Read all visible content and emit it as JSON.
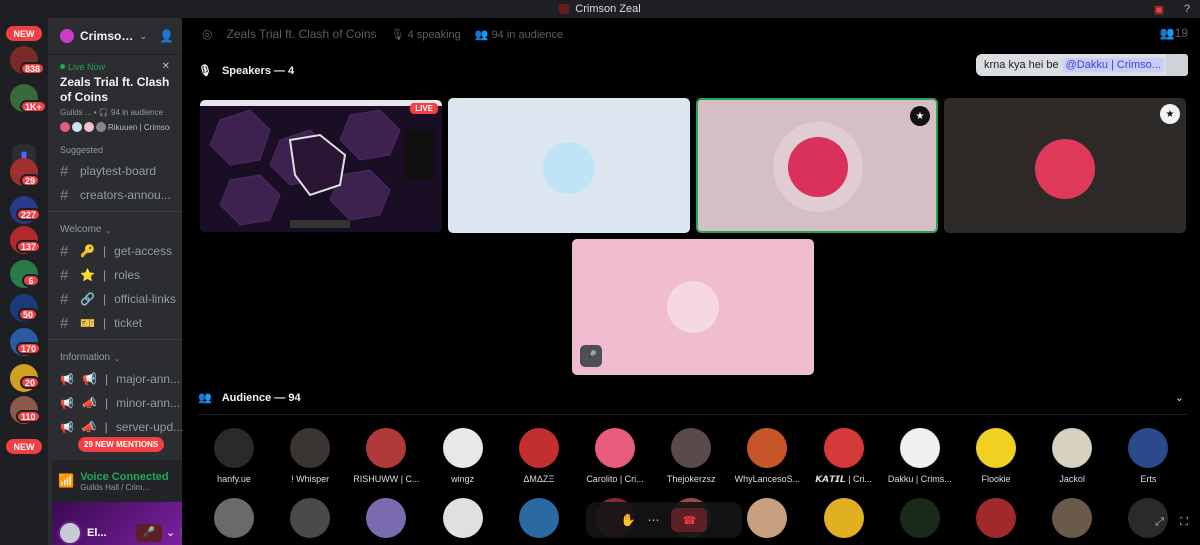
{
  "window": {
    "title": "Crimson Zeal"
  },
  "rail": {
    "new_top": "NEW",
    "new_bottom": "NEW",
    "badges": [
      "838",
      "1K+",
      "29",
      "227",
      "137",
      "6",
      "50",
      "170",
      "20",
      "110"
    ]
  },
  "sidebar": {
    "server_name": "Crimson ...",
    "live": {
      "status": "Live Now",
      "title": "Zeals Trial ft. Clash of Coins",
      "meta_location": "Guilds ...",
      "meta_audience": "94 in audience",
      "speakers_line": "Rikuuen | Crimson Z..."
    },
    "cat_suggested": "Suggested",
    "channels_suggested": [
      "playtest-board",
      "creators-annou..."
    ],
    "cat_welcome": "Welcome",
    "channels_welcome": [
      {
        "emoji": "🔑",
        "name": "get-access"
      },
      {
        "emoji": "⭐",
        "name": "roles"
      },
      {
        "emoji": "🔗",
        "name": "official-links"
      },
      {
        "emoji": "🎫",
        "name": "ticket"
      }
    ],
    "cat_information": "Information",
    "channels_information": [
      {
        "emoji": "📢",
        "name": "major-ann..."
      },
      {
        "emoji": "📣",
        "name": "minor-ann..."
      },
      {
        "emoji": "📣",
        "name": "server-upd..."
      }
    ],
    "mentions": "29 NEW MENTIONS",
    "voice": {
      "status": "Voice Connected",
      "location": "Guilds Hall / Crim..."
    },
    "user": {
      "name": "El..."
    }
  },
  "stage": {
    "title": "Zeals Trial ft. Clash of Coins",
    "speaking": "4 speaking",
    "audience_count": "94 in audience",
    "notif_count": "19",
    "speakers_heading": "Speakers — 4",
    "message": {
      "text": "krna kya hei be",
      "mention": "@Dakku | Crimso..."
    },
    "live_label": "LIVE",
    "audience_heading": "Audience — 94",
    "audience": [
      {
        "name": "hanfy.ue",
        "color": "#2a2a2a"
      },
      {
        "name": "! Whisper",
        "color": "#3a3532"
      },
      {
        "name": "RISHUWW | C...",
        "color": "#b03a3a"
      },
      {
        "name": "wingz",
        "color": "#e8e8e8"
      },
      {
        "name": "ΔMΔZΞ",
        "color": "#c03030"
      },
      {
        "name": "Carolito | Cri...",
        "color": "#e85b7a"
      },
      {
        "name": "Thejokerzsz",
        "color": "#5a4a4a"
      },
      {
        "name": "WhyLancesoS...",
        "color": "#c8552a"
      },
      {
        "name": "𝙆𝘼𝙏𝙄𝙇 | Cri...",
        "color": "#d43a3a"
      },
      {
        "name": "Dakku | Crims...",
        "color": "#f0f0f0"
      },
      {
        "name": "Flookie",
        "color": "#f0d020"
      },
      {
        "name": "Jackol",
        "color": "#d9d0c0"
      },
      {
        "name": "Erts",
        "color": "#2a4a8a"
      }
    ]
  }
}
